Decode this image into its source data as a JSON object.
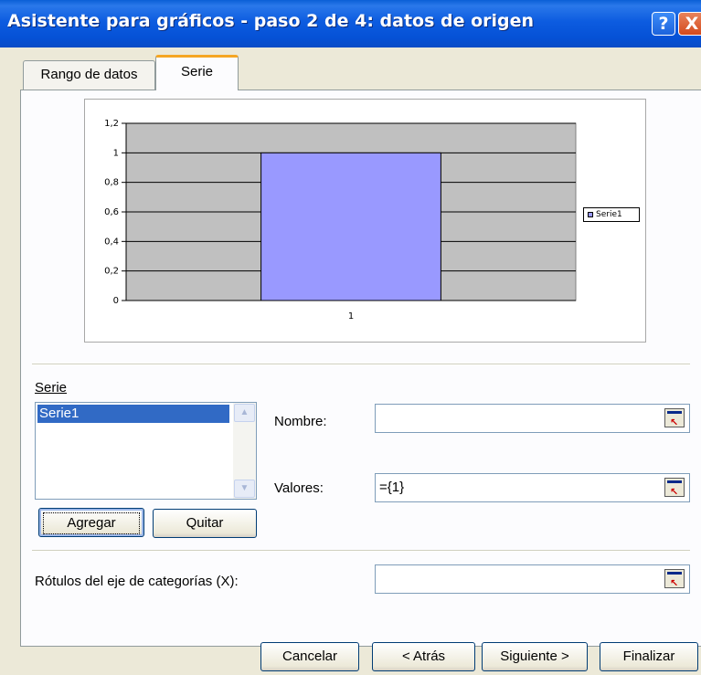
{
  "window": {
    "title": "Asistente para gráficos - paso 2 de 4: datos de origen",
    "help_label": "?",
    "close_label": "X"
  },
  "tabs": [
    {
      "label": "Rango de datos",
      "active": false
    },
    {
      "label": "Serie",
      "active": true
    }
  ],
  "chart_data": {
    "type": "bar",
    "categories": [
      "1"
    ],
    "series": [
      {
        "name": "Serie1",
        "values": [
          1
        ],
        "color": "#9999ff"
      }
    ],
    "ylim": [
      0,
      1.2
    ],
    "yticks": [
      "0",
      "0,2",
      "0,4",
      "0,6",
      "0,8",
      "1",
      "1,2"
    ],
    "grid": true,
    "plot_background": "#c0c0c0",
    "legend": "right"
  },
  "series_section": {
    "label": "Serie",
    "items": [
      "Serie1"
    ],
    "selected": "Serie1",
    "add_label": "Agregar",
    "remove_label": "Quitar"
  },
  "fields": {
    "name_label": "Nombre:",
    "name_value": "",
    "values_label": "Valores:",
    "values_value": "={1}",
    "category_label": "Rótulos del eje de categorías (X):",
    "category_value": ""
  },
  "footer": {
    "cancel": "Cancelar",
    "back": "< Atrás",
    "next": "Siguiente >",
    "finish": "Finalizar"
  }
}
